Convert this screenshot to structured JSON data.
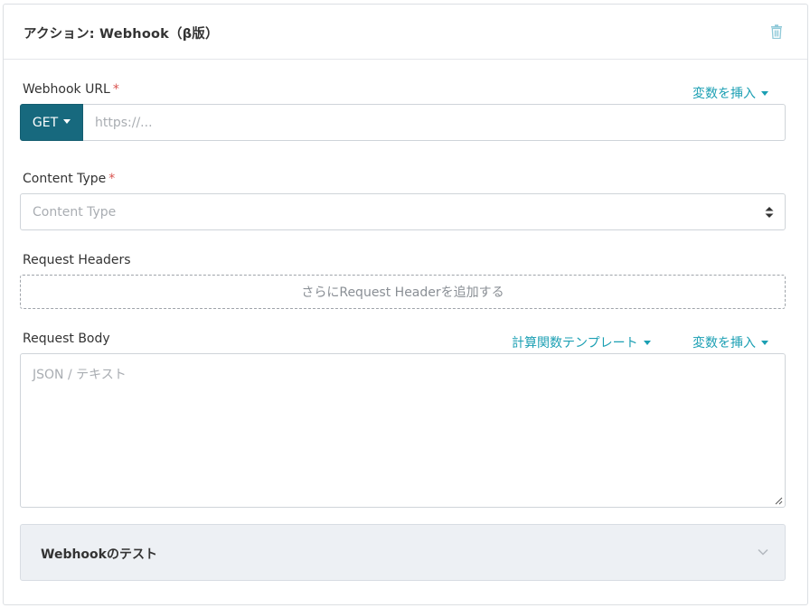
{
  "header": {
    "title": "アクション: Webhook（β版）",
    "delete_icon": "trash-icon"
  },
  "webhook_url": {
    "label": "Webhook URL",
    "required_mark": "*",
    "insert_variable": "変数を挿入",
    "method": "GET",
    "placeholder": "https://..."
  },
  "content_type": {
    "label": "Content Type",
    "required_mark": "*",
    "placeholder": "Content Type"
  },
  "request_headers": {
    "label": "Request Headers",
    "add_button": "さらにRequest Headerを追加する"
  },
  "request_body": {
    "label": "Request Body",
    "template_link": "計算関数テンプレート",
    "insert_variable": "変数を挿入",
    "placeholder": "JSON / テキスト"
  },
  "test_section": {
    "title": "Webhookのテスト"
  },
  "colors": {
    "accent": "#1b9fb3",
    "primary_button": "#17697e",
    "required": "#d9534f"
  }
}
